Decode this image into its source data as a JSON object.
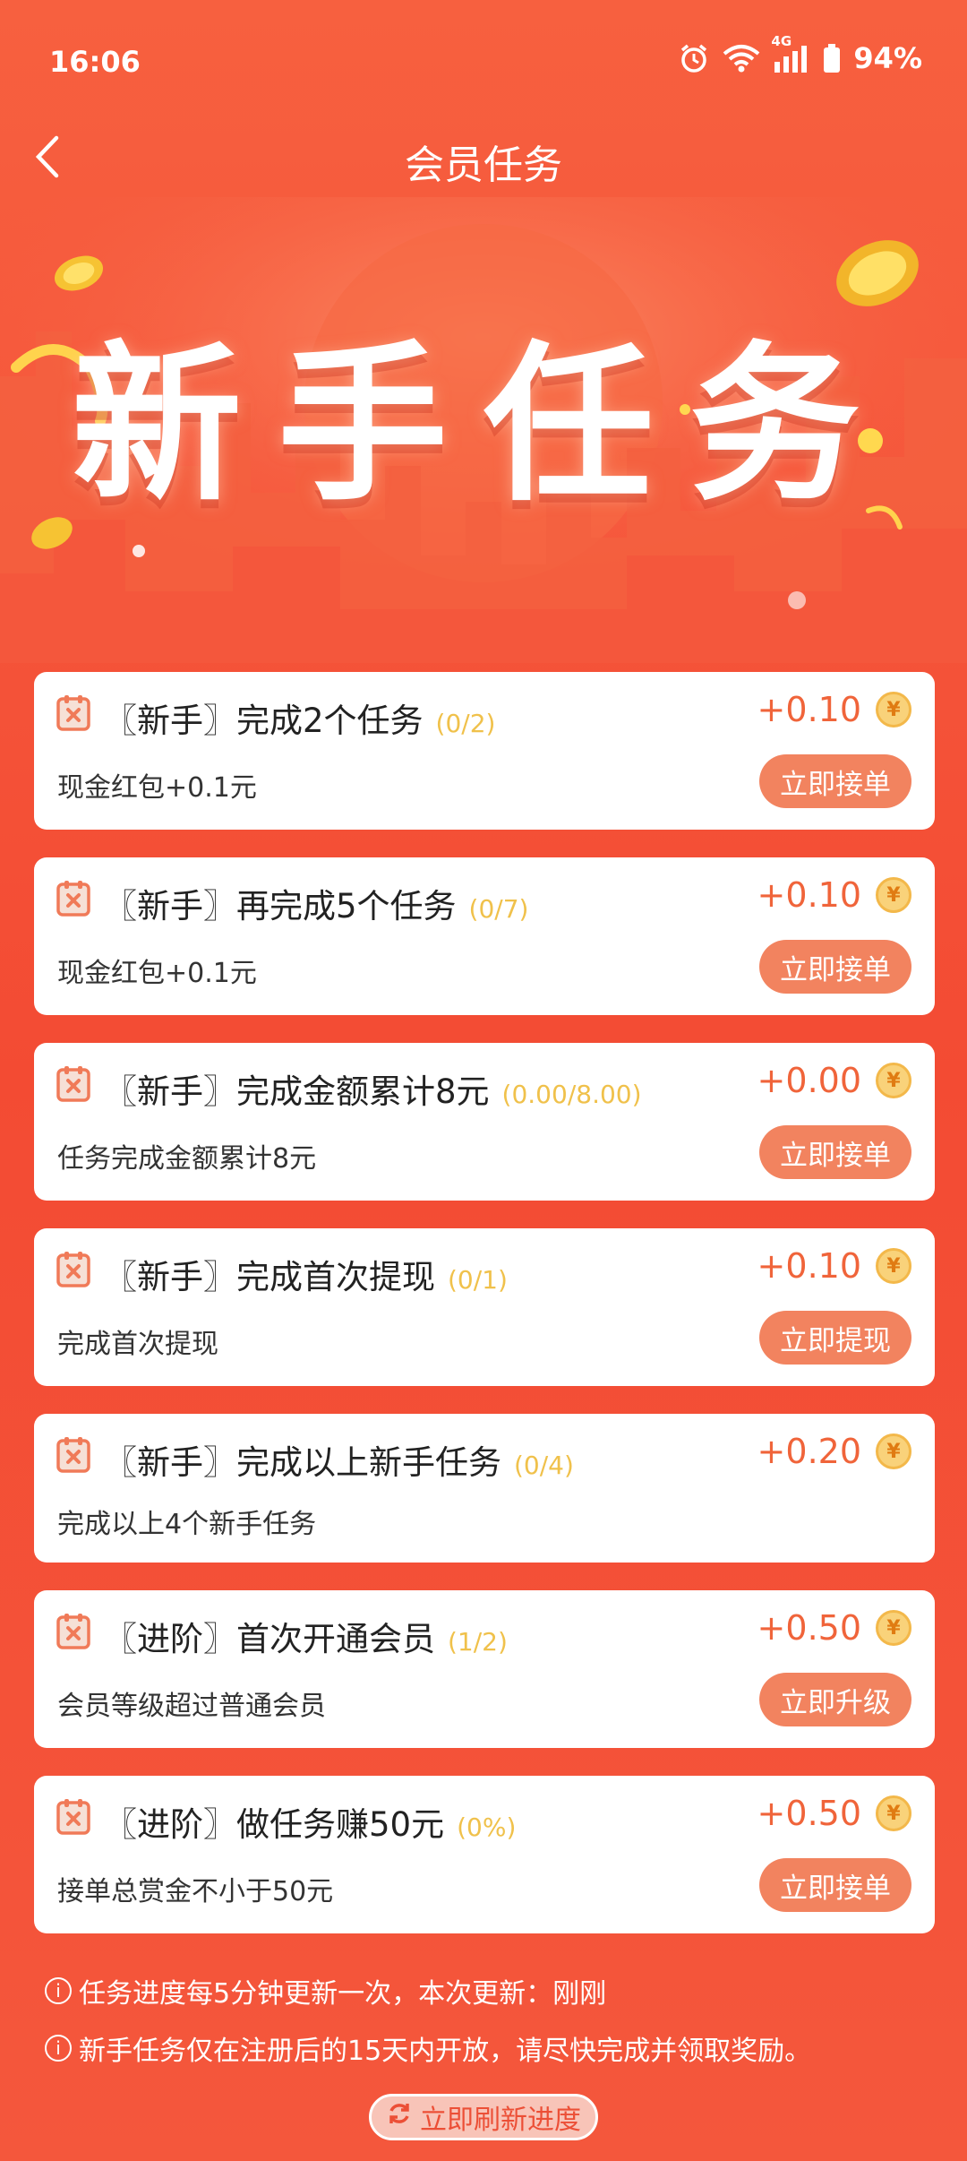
{
  "status": {
    "time": "16:06",
    "network": "4G",
    "battery": "94%",
    "icons": [
      "alarm-icon",
      "wifi-icon",
      "signal-icon",
      "battery-icon"
    ]
  },
  "nav": {
    "back_icon": "chevron-left-icon",
    "title": "会员任务"
  },
  "banner": {
    "title": "新手任务"
  },
  "tasks": [
    {
      "title": "〖新手〗完成2个任务",
      "progress": "(0/2)",
      "reward": "+0.10",
      "desc": "现金红包+0.1元",
      "button": "立即接单"
    },
    {
      "title": "〖新手〗再完成5个任务",
      "progress": "(0/7)",
      "reward": "+0.10",
      "desc": "现金红包+0.1元",
      "button": "立即接单"
    },
    {
      "title": "〖新手〗完成金额累计8元",
      "progress": "(0.00/8.00)",
      "reward": "+0.00",
      "desc": "任务完成金额累计8元",
      "button": "立即接单"
    },
    {
      "title": "〖新手〗完成首次提现",
      "progress": "(0/1)",
      "reward": "+0.10",
      "desc": "完成首次提现",
      "button": "立即提现"
    },
    {
      "title": "〖新手〗完成以上新手任务",
      "progress": "(0/4)",
      "reward": "+0.20",
      "desc": "完成以上4个新手任务",
      "button": ""
    },
    {
      "title": "〖进阶〗首次开通会员",
      "progress": "(1/2)",
      "reward": "+0.50",
      "desc": "会员等级超过普通会员",
      "button": "立即升级"
    },
    {
      "title": "〖进阶〗做任务赚50元",
      "progress": "(0%)",
      "reward": "+0.50",
      "desc": "接单总赏金不小于50元",
      "button": "立即接单"
    }
  ],
  "coin_symbol": "¥",
  "notes": [
    "任务进度每5分钟更新一次，本次更新：刚刚",
    "新手任务仅在注册后的15天内开放，请尽快完成并领取奖励。"
  ],
  "note_icon": "i",
  "refresh_button": "立即刷新进度",
  "colors": {
    "background": "#f5553a",
    "accent": "#f0643a",
    "button": "#f2835f",
    "progress": "#f0c14b"
  }
}
